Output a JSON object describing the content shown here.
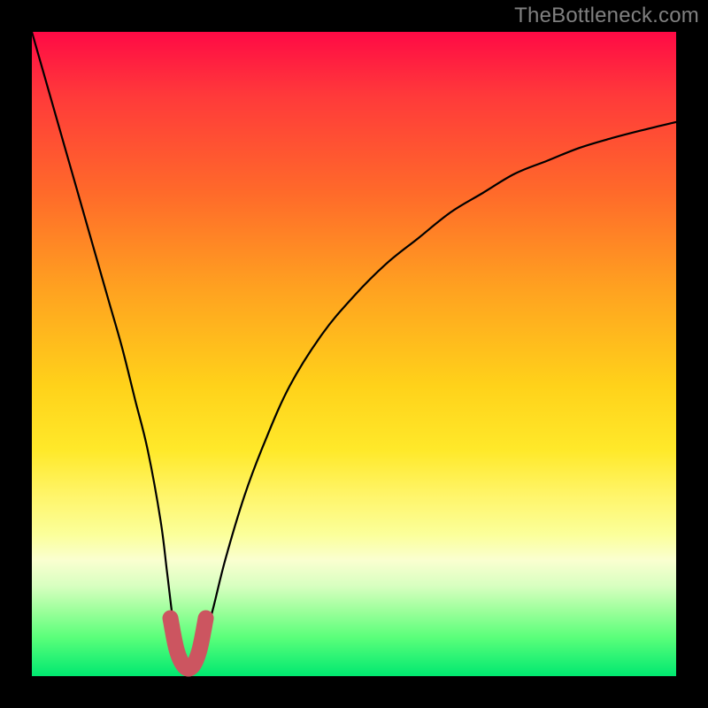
{
  "watermark": "TheBottleneck.com",
  "chart_data": {
    "type": "line",
    "title": "",
    "xlabel": "",
    "ylabel": "",
    "xlim": [
      0,
      100
    ],
    "ylim": [
      0,
      100
    ],
    "series": [
      {
        "name": "bottleneck-curve",
        "x": [
          0,
          2,
          4,
          6,
          8,
          10,
          12,
          14,
          16,
          18,
          20,
          21,
          22,
          23,
          24,
          25,
          26,
          28,
          30,
          33,
          36,
          40,
          45,
          50,
          55,
          60,
          65,
          70,
          75,
          80,
          85,
          90,
          95,
          100
        ],
        "values": [
          100,
          93,
          86,
          79,
          72,
          65,
          58,
          51,
          43,
          35,
          24,
          16,
          8,
          3,
          1,
          1,
          3,
          10,
          18,
          28,
          36,
          45,
          53,
          59,
          64,
          68,
          72,
          75,
          78,
          80,
          82,
          83.5,
          84.8,
          86
        ]
      }
    ],
    "marker": {
      "name": "optimal-region",
      "points": [
        {
          "x": 21.5,
          "y": 9
        },
        {
          "x": 22.5,
          "y": 4
        },
        {
          "x": 23.7,
          "y": 1.5
        },
        {
          "x": 24.9,
          "y": 1.5
        },
        {
          "x": 26.0,
          "y": 4
        },
        {
          "x": 27.0,
          "y": 9
        }
      ],
      "color": "#cc5560"
    },
    "gradient_stops": [
      {
        "pos": 0,
        "color": "#ff0a45"
      },
      {
        "pos": 10,
        "color": "#ff3a3a"
      },
      {
        "pos": 25,
        "color": "#ff6a2a"
      },
      {
        "pos": 40,
        "color": "#ffa220"
      },
      {
        "pos": 55,
        "color": "#ffd21a"
      },
      {
        "pos": 65,
        "color": "#ffe92a"
      },
      {
        "pos": 72,
        "color": "#fff56a"
      },
      {
        "pos": 78,
        "color": "#fbff9a"
      },
      {
        "pos": 82,
        "color": "#faffd0"
      },
      {
        "pos": 86,
        "color": "#d8ffc0"
      },
      {
        "pos": 90,
        "color": "#9aff9a"
      },
      {
        "pos": 94,
        "color": "#5aff7a"
      },
      {
        "pos": 100,
        "color": "#00e870"
      }
    ]
  }
}
